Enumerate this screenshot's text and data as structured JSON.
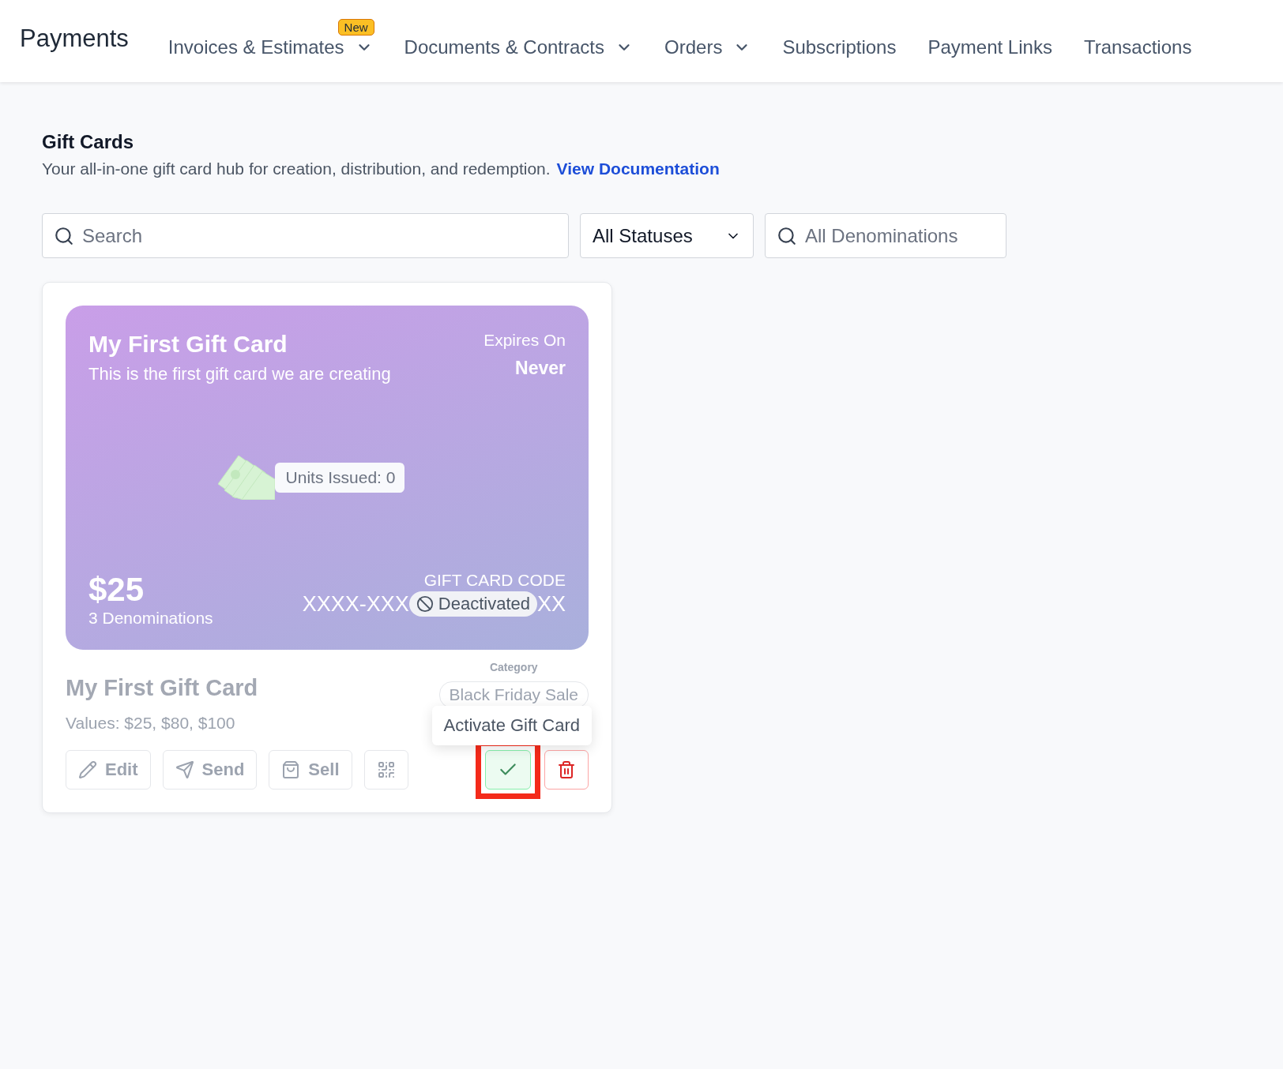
{
  "nav": {
    "title": "Payments",
    "items": [
      {
        "label": "Invoices & Estimates",
        "dropdown": true,
        "badge": "New"
      },
      {
        "label": "Documents & Contracts",
        "dropdown": true
      },
      {
        "label": "Orders",
        "dropdown": true
      },
      {
        "label": "Subscriptions",
        "dropdown": false
      },
      {
        "label": "Payment Links",
        "dropdown": false
      },
      {
        "label": "Transactions",
        "dropdown": false
      }
    ]
  },
  "page": {
    "title": "Gift Cards",
    "description": "Your all-in-one gift card hub for creation, distribution, and redemption.",
    "link": "View Documentation"
  },
  "filters": {
    "search": {
      "placeholder": "Search"
    },
    "status": {
      "value": "All Statuses"
    },
    "denominations": {
      "placeholder": "All Denominations"
    }
  },
  "card": {
    "name": "My First Gift Card",
    "description": "This is the first gift card we are creating",
    "expires_label": "Expires On",
    "expires_value": "Never",
    "units_issued": "Units Issued: 0",
    "amount": "$25",
    "denominations": "3 Denominations",
    "code_label": "GIFT CARD CODE",
    "code_parts": [
      "XXXX-XXX",
      "XX"
    ],
    "status": "Deactivated",
    "active": false,
    "title": "My First Gift Card",
    "category_label": "Category",
    "category": "Black Friday Sale",
    "values": "Values: $25, $80, $100",
    "actions": [
      {
        "kind": "edit",
        "label": "Edit"
      },
      {
        "kind": "send",
        "label": "Send"
      },
      {
        "kind": "sell",
        "label": "Sell"
      },
      {
        "kind": "qr"
      }
    ],
    "activate": {
      "tooltip": "Activate Gift Card",
      "highlighted": true
    }
  }
}
